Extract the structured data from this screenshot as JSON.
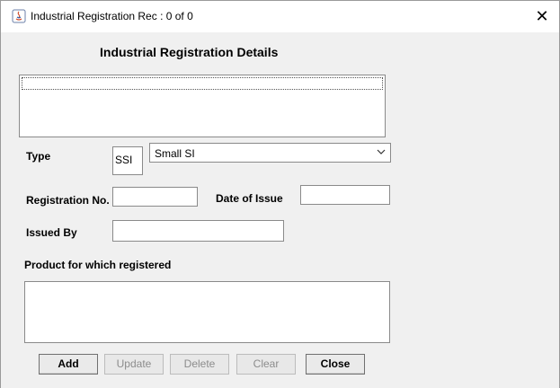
{
  "window": {
    "title": "Industrial Registration  Rec : 0 of 0",
    "close_glyph": "✕"
  },
  "form": {
    "heading": "Industrial Registration  Details",
    "type_label": "Type",
    "type_code": "SSI",
    "type_selected": "Small SI",
    "registration_no_label": "Registration No.",
    "registration_no_value": "",
    "date_of_issue_label": "Date of Issue",
    "date_of_issue_value": "",
    "issued_by_label": "Issued By",
    "issued_by_value": "",
    "product_label": "Product for which registered",
    "product_value": ""
  },
  "buttons": {
    "add": "Add",
    "update": "Update",
    "delete": "Delete",
    "clear": "Clear",
    "close": "Close"
  },
  "icons": {
    "app": "java-icon",
    "close": "close-icon",
    "dropdown": "chevron-down-icon"
  }
}
